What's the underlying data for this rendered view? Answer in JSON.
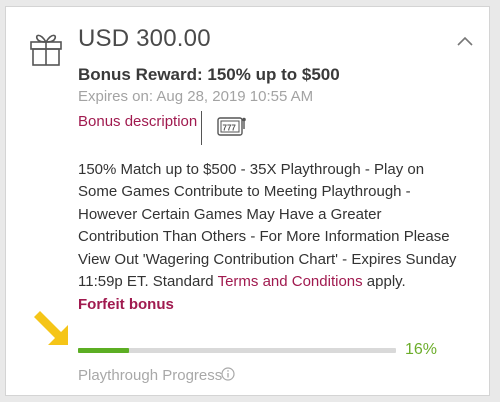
{
  "bonus": {
    "amount": "USD 300.00",
    "title": "Bonus Reward: 150% up to $500",
    "expires": "Expires on: Aug 28, 2019 10:55 AM",
    "description_link": "Bonus description",
    "game_icon": "slot-machine-icon",
    "gift_icon": "gift-icon",
    "collapse_icon": "chevron-up-icon",
    "text_main": "150% Match up to $500 - 35X Playthrough - Play on Some Games Contribute to Meeting Playthrough - However Certain Games May Have a Greater Contribution Than Others - For More Information Please View Out 'Wagering Contribution Chart' - Expires Sunday 11:59p ET. Standard ",
    "terms_link": "Terms and Conditions",
    "text_tail": " apply.",
    "forfeit": "Forfeit bonus"
  },
  "progress": {
    "percent_label": "16%",
    "fraction": 0.16,
    "label": "Playthrough Progress",
    "info_icon": "info-icon"
  },
  "colors": {
    "accent": "#a01a4f",
    "progress": "#5cae23",
    "annotation_arrow": "#f5c518"
  }
}
